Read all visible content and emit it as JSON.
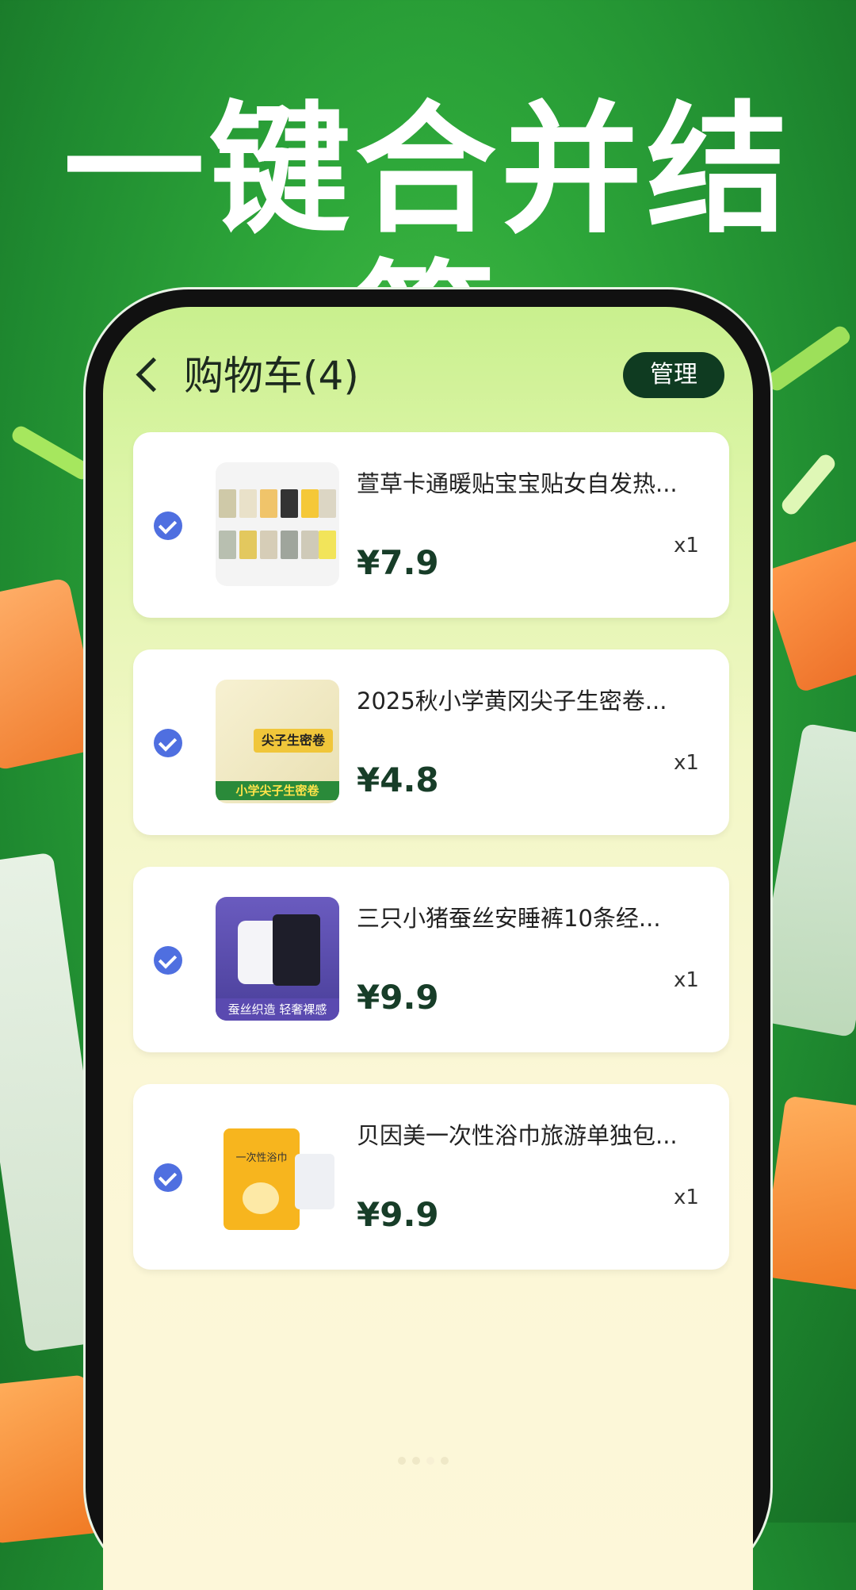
{
  "headline": "一键合并结算",
  "cart": {
    "title": "购物车(4)",
    "manage_label": "管理",
    "items": [
      {
        "name": "萱草卡通暖贴宝宝贴女自发热...",
        "price": "¥7.9",
        "qty": "x1"
      },
      {
        "name": "2025秋小学黄冈尖子生密卷...",
        "price": "¥4.8",
        "qty": "x1"
      },
      {
        "name": "三只小猪蚕丝安睡裤10条经...",
        "price": "¥9.9",
        "qty": "x1"
      },
      {
        "name": "贝因美一次性浴巾旅游单独包...",
        "price": "¥9.9",
        "qty": "x1"
      }
    ]
  },
  "thumb_text": {
    "item2": "尖子生密卷",
    "item2_sub": "小学尖子生密卷",
    "item3": "蚕丝织造 轻奢裸感",
    "item4": "一次性浴巾"
  },
  "colors": {
    "background": "#2ea83a",
    "manage_button": "#0f3b21",
    "check": "#4f6fe0",
    "price": "#173d28"
  }
}
